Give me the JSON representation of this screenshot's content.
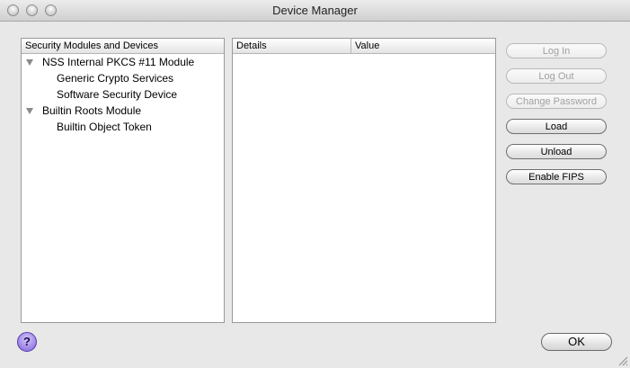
{
  "window": {
    "title": "Device Manager"
  },
  "tree": {
    "header": "Security Modules and Devices",
    "items": [
      {
        "label": "NSS Internal PKCS #11 Module",
        "level": 0,
        "expanded": true
      },
      {
        "label": "Generic Crypto Services",
        "level": 1
      },
      {
        "label": "Software Security Device",
        "level": 1
      },
      {
        "label": "Builtin Roots Module",
        "level": 0,
        "expanded": true
      },
      {
        "label": "Builtin Object Token",
        "level": 1
      }
    ]
  },
  "details": {
    "col_details": "Details",
    "col_value": "Value"
  },
  "buttons": {
    "login": {
      "label": "Log In",
      "enabled": false
    },
    "logout": {
      "label": "Log Out",
      "enabled": false
    },
    "change_password": {
      "label": "Change Password",
      "enabled": false
    },
    "load": {
      "label": "Load",
      "enabled": true
    },
    "unload": {
      "label": "Unload",
      "enabled": true
    },
    "enable_fips": {
      "label": "Enable FIPS",
      "enabled": true
    }
  },
  "footer": {
    "help_label": "?",
    "ok_label": "OK"
  }
}
